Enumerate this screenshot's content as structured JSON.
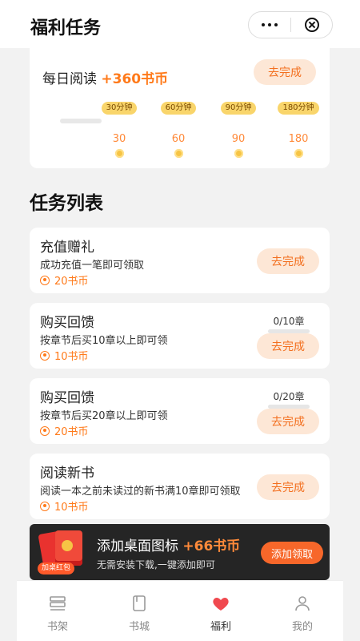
{
  "header": {
    "title": "福利任务"
  },
  "daily": {
    "label": "每日阅读",
    "bonus": "+360书币",
    "button": "去完成",
    "milestones": [
      {
        "tag": "30分钟",
        "value": "30"
      },
      {
        "tag": "60分钟",
        "value": "60"
      },
      {
        "tag": "90分钟",
        "value": "90"
      },
      {
        "tag": "180分钟",
        "value": "180"
      }
    ]
  },
  "section_title": "任务列表",
  "tasks": [
    {
      "name": "充值赠礼",
      "desc": "成功充值一笔即可领取",
      "reward": "20书币",
      "button": "去完成"
    },
    {
      "name": "购买回馈",
      "desc": "按章节后买10章以上即可领",
      "reward": "10书币",
      "button": "去完成",
      "progress": "0/10章"
    },
    {
      "name": "购买回馈",
      "desc": "按章节后买20章以上即可领",
      "reward": "20书币",
      "button": "去完成",
      "progress": "0/20章"
    },
    {
      "name": "阅读新书",
      "desc": "阅读一本之前未读过的新书满10章即可领取",
      "reward": "10书币",
      "button": "去完成"
    }
  ],
  "banner": {
    "tag": "加桌红包",
    "title": "添加桌面图标",
    "bonus": "+66书币",
    "subtitle": "无需安装下载,一键添加即可",
    "button": "添加领取"
  },
  "tabbar": {
    "items": [
      {
        "label": "书架",
        "icon": "bookshelf-icon"
      },
      {
        "label": "书城",
        "icon": "book-icon"
      },
      {
        "label": "福利",
        "icon": "heart-icon"
      },
      {
        "label": "我的",
        "icon": "user-icon"
      }
    ],
    "active": "福利",
    "accent": "#f0494f"
  },
  "colors": {
    "accent": "#ff7a1a",
    "button_bg": "#fde7d6"
  }
}
